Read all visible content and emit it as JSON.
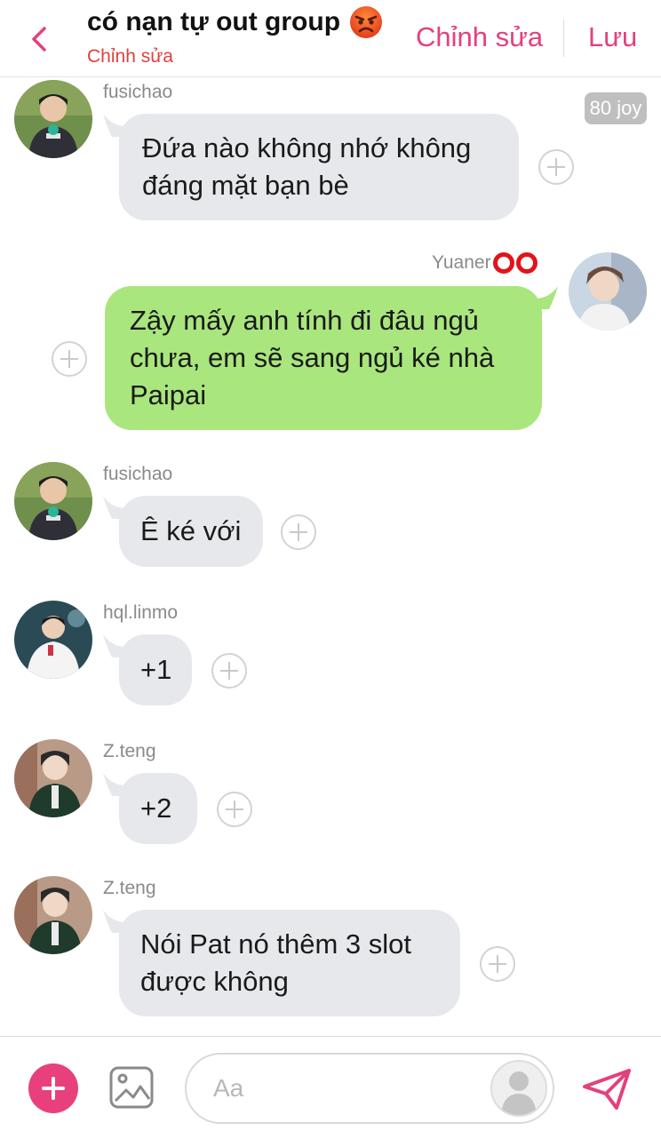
{
  "header": {
    "title": "có nạn tự out group",
    "subtitle": "Chỉnh sửa",
    "edit_label": "Chỉnh sửa",
    "save_label": "Lưu"
  },
  "badge": {
    "joy_label": "80 joy"
  },
  "messages": [
    {
      "sender": "fusichao",
      "lines": "Đứa nào không nhớ không\nđáng mặt bạn bè"
    },
    {
      "sender": "Yuaner",
      "lines": "Zậy mấy anh tính đi đâu ngủ\nchưa, em sẽ sang ngủ ké nhà\nPaipai"
    },
    {
      "sender": "fusichao",
      "lines": "Ê ké với"
    },
    {
      "sender": "hql.linmo",
      "lines": "+1"
    },
    {
      "sender": "Z.teng",
      "lines": "+2"
    },
    {
      "sender": "Z.teng",
      "lines": "Nói Pat nó thêm 3 slot\nđược không"
    }
  ],
  "composer": {
    "placeholder": "Aa"
  },
  "colors": {
    "accent": "#e4407e",
    "my_bubble": "#a9e67d",
    "other_bubble": "#e7e8ec",
    "subtitle": "#e0413b"
  },
  "icons": [
    "back-chevron-icon",
    "angry-face-icon",
    "plus-icon",
    "image-icon",
    "send-icon",
    "avatar-placeholder-icon",
    "red-rings-icon"
  ]
}
